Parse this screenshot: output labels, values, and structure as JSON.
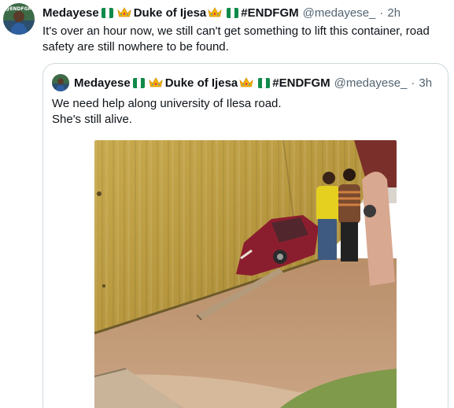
{
  "tweet": {
    "display_name": "Medayese",
    "name_suffix": "Duke of Ijesa",
    "hashtag": "#ENDFGM",
    "handle": "@medayese_",
    "separator": "·",
    "time": "2h",
    "text": "It's over an hour now, we still can't get something to lift this container, road safety are still nowhere to be found.",
    "avatar_text": "@ENDFGM"
  },
  "quoted": {
    "display_name": "Medayese",
    "name_suffix": "Duke of Ijesa",
    "hashtag": "#ENDFGM",
    "handle": "@medayese_",
    "separator": "·",
    "time": "3h",
    "line1": "We need help along university of Ilesa road.",
    "line2": "She's still alive."
  },
  "icons": {
    "flag": "nigeria-flag-icon",
    "crown": "crown-icon"
  },
  "colors": {
    "text_primary": "#0f1419",
    "text_secondary": "#536471",
    "border": "#cfd9de",
    "flag_green": "#108a4a",
    "crown_gold": "#f5b400"
  }
}
